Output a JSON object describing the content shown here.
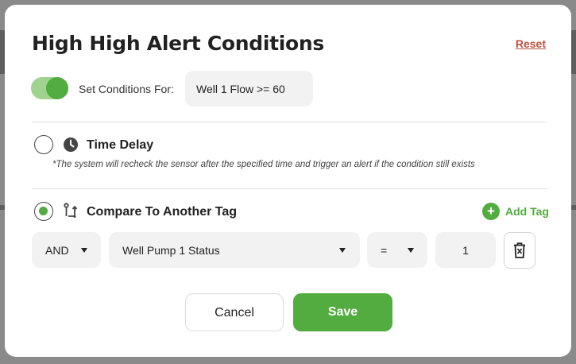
{
  "dialog": {
    "title": "High High Alert Conditions",
    "reset_label": "Reset"
  },
  "set_conditions": {
    "label": "Set Conditions For:",
    "toggle_on": true,
    "value": "Well 1 Flow >= 60"
  },
  "time_delay": {
    "title": "Time Delay",
    "selected": false,
    "icon": "clock-icon",
    "note": "*The system will recheck the sensor after the specified time and trigger an alert if the condition still exists"
  },
  "compare_tag": {
    "title": "Compare To Another Tag",
    "selected": true,
    "icon": "compare-arrows-icon",
    "add_tag_label": "Add Tag",
    "row": {
      "logic": "AND",
      "tag": "Well Pump 1 Status",
      "operator": "=",
      "value": "1"
    }
  },
  "buttons": {
    "cancel": "Cancel",
    "save": "Save"
  },
  "colors": {
    "accent": "#52ac3f",
    "reset": "#c0533f"
  }
}
